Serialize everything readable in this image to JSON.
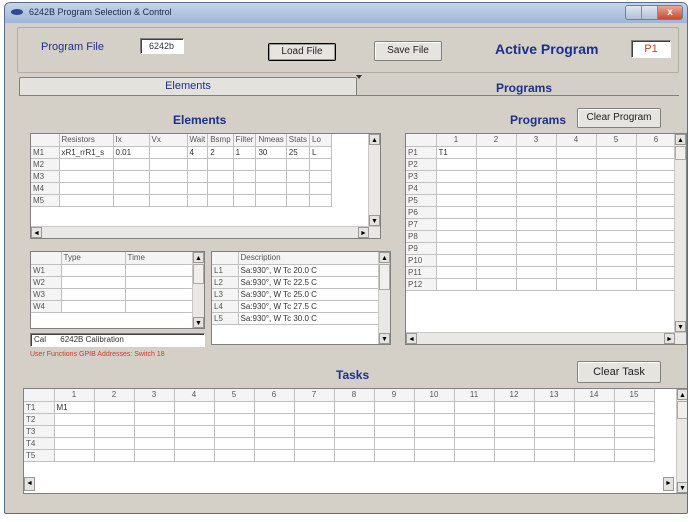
{
  "window": {
    "title": "6242B Program Selection & Control"
  },
  "header": {
    "program_file_label": "Program File",
    "program_file_value": "6242b",
    "load_file": "Load File",
    "save_file": "Save File",
    "active_program_label": "Active Program",
    "active_program_value": "P1"
  },
  "tabs": {
    "elements": "Elements",
    "programs": "Programs"
  },
  "elements": {
    "title": "Elements",
    "columns": [
      "",
      "Resistors",
      "Ix",
      "Vx",
      "Wait",
      "Bsmp",
      "Filter",
      "Nmeas",
      "Stats",
      "Lo"
    ],
    "rows": [
      [
        "M1",
        "xR1_rrR1_s",
        "0.01",
        "",
        "4",
        "2",
        "1",
        "30",
        "25",
        "L"
      ],
      [
        "M2",
        "",
        "",
        "",
        "",
        "",
        "",
        "",
        "",
        ""
      ],
      [
        "M3",
        "",
        "",
        "",
        "",
        "",
        "",
        "",
        "",
        ""
      ],
      [
        "M4",
        "",
        "",
        "",
        "",
        "",
        "",
        "",
        "",
        ""
      ],
      [
        "M5",
        "",
        "",
        "",
        "",
        "",
        "",
        "",
        "",
        ""
      ]
    ]
  },
  "waits": {
    "columns": [
      "",
      "Type",
      "Time"
    ],
    "rows": [
      [
        "W1",
        "",
        ""
      ],
      [
        "W2",
        "",
        ""
      ],
      [
        "W3",
        "",
        ""
      ],
      [
        "W4",
        "",
        ""
      ]
    ]
  },
  "loops": {
    "columns": [
      "",
      "Description"
    ],
    "rows": [
      [
        "L1",
        "Sa:930°, W Tc 20.0 C"
      ],
      [
        "L2",
        "Sa:930°, W Tc 22.5 C"
      ],
      [
        "L3",
        "Sa:930°, W Tc 25.0 C"
      ],
      [
        "L4",
        "Sa:930°, W Tc 27.5 C"
      ],
      [
        "L5",
        "Sa:930°, W Tc 30.0 C"
      ]
    ]
  },
  "cal": {
    "label": "Cal",
    "value": "6242B Calibration"
  },
  "user_functions_text": "User Functions GPIB Addresses: Switch 18",
  "programs": {
    "title": "Programs",
    "clear_button": "Clear Program",
    "columns": [
      "",
      "1",
      "2",
      "3",
      "4",
      "5",
      "6"
    ],
    "rows": [
      [
        "P1",
        "T1",
        "",
        "",
        "",
        "",
        ""
      ],
      [
        "P2",
        "",
        "",
        "",
        "",
        "",
        ""
      ],
      [
        "P3",
        "",
        "",
        "",
        "",
        "",
        ""
      ],
      [
        "P4",
        "",
        "",
        "",
        "",
        "",
        ""
      ],
      [
        "P5",
        "",
        "",
        "",
        "",
        "",
        ""
      ],
      [
        "P6",
        "",
        "",
        "",
        "",
        "",
        ""
      ],
      [
        "P7",
        "",
        "",
        "",
        "",
        "",
        ""
      ],
      [
        "P8",
        "",
        "",
        "",
        "",
        "",
        ""
      ],
      [
        "P9",
        "",
        "",
        "",
        "",
        "",
        ""
      ],
      [
        "P10",
        "",
        "",
        "",
        "",
        "",
        ""
      ],
      [
        "P11",
        "",
        "",
        "",
        "",
        "",
        ""
      ],
      [
        "P12",
        "",
        "",
        "",
        "",
        "",
        ""
      ]
    ]
  },
  "tasks": {
    "title": "Tasks",
    "clear_button": "Clear Task",
    "columns": [
      "",
      "1",
      "2",
      "3",
      "4",
      "5",
      "6",
      "7",
      "8",
      "9",
      "10",
      "11",
      "12",
      "13",
      "14",
      "15"
    ],
    "rows": [
      [
        "T1",
        "M1",
        "",
        "",
        "",
        "",
        "",
        "",
        "",
        "",
        "",
        "",
        "",
        "",
        "",
        ""
      ],
      [
        "T2",
        "",
        "",
        "",
        "",
        "",
        "",
        "",
        "",
        "",
        "",
        "",
        "",
        "",
        "",
        ""
      ],
      [
        "T3",
        "",
        "",
        "",
        "",
        "",
        "",
        "",
        "",
        "",
        "",
        "",
        "",
        "",
        "",
        ""
      ],
      [
        "T4",
        "",
        "",
        "",
        "",
        "",
        "",
        "",
        "",
        "",
        "",
        "",
        "",
        "",
        "",
        ""
      ],
      [
        "T5",
        "",
        "",
        "",
        "",
        "",
        "",
        "",
        "",
        "",
        "",
        "",
        "",
        "",
        "",
        ""
      ]
    ]
  },
  "colors": {
    "accent_blue": "#1c2f8c",
    "error_red": "#d03a2a",
    "face": "#d4d0c8"
  }
}
